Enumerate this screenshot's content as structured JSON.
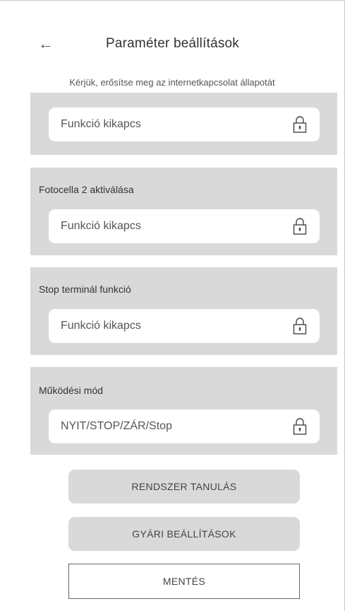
{
  "header": {
    "back_icon": "arrow-left-icon",
    "back_glyph": "←",
    "title": "Paraméter beállítások"
  },
  "subtitle": "Kérjük, erősítse meg az internetkapcsolat állapotát",
  "panels": [
    {
      "label": "",
      "value": "Funkció kikapcs",
      "icon": "lock-icon"
    },
    {
      "label": "Fotocella 2 aktiválása",
      "value": "Funkció kikapcs",
      "icon": "lock-icon"
    },
    {
      "label": "Stop terminál funkció",
      "value": "Funkció kikapcs",
      "icon": "lock-icon"
    },
    {
      "label": "Működési mód",
      "value": "NYIT/STOP/ZÁR/Stop",
      "icon": "lock-icon"
    }
  ],
  "buttons": {
    "learn": "RENDSZER TANULÁS",
    "factory": "GYÁRI BEÁLLÍTÁSOK",
    "save": "MENTÉS"
  },
  "colors": {
    "panel_bg": "#d9d9d9",
    "field_bg": "#ffffff",
    "text": "#3a3a3a"
  }
}
